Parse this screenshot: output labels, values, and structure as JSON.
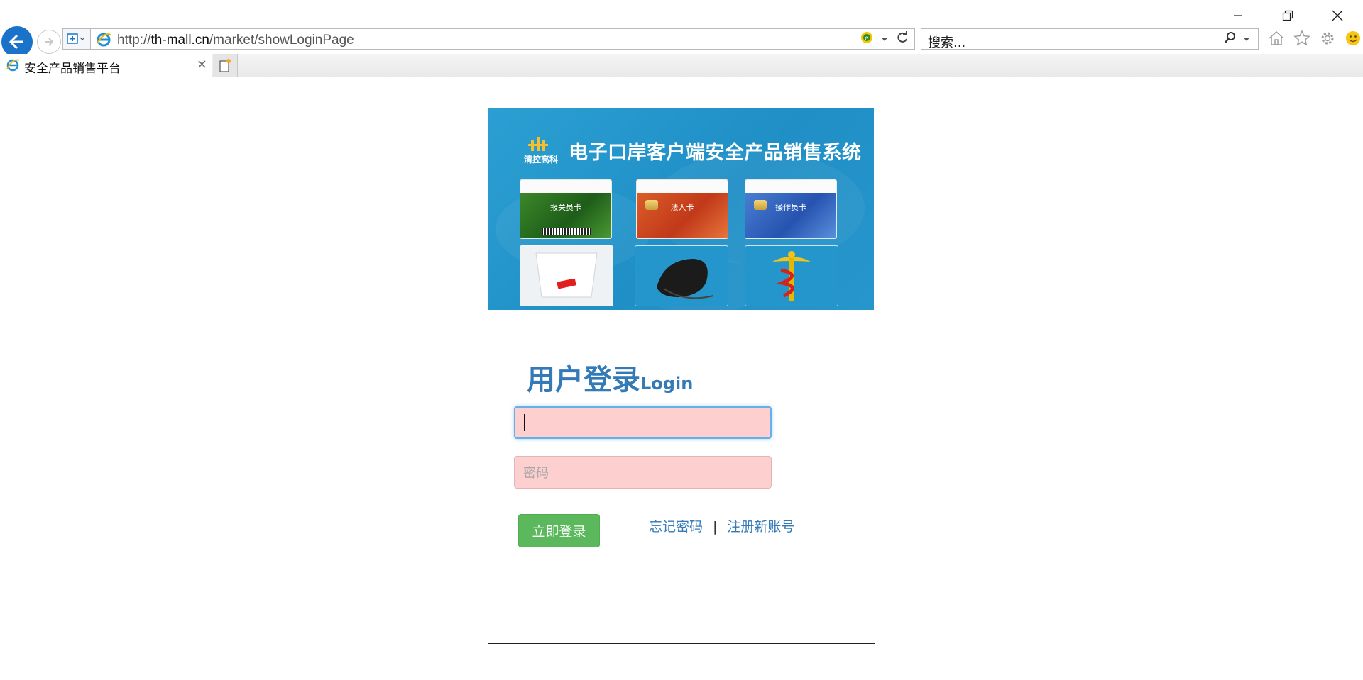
{
  "browser": {
    "url_prefix": "http://",
    "url_domain": "th-mall.cn",
    "url_path": "/market/showLoginPage",
    "search_placeholder": "搜索...",
    "tab_title": "安全产品销售平台",
    "window_controls": [
      "minimize-icon",
      "restore-icon",
      "close-icon"
    ],
    "tool_icons": [
      "home-icon",
      "favorites-star-icon",
      "settings-gear-icon",
      "smiley-feedback-icon"
    ]
  },
  "banner": {
    "logo_text": "清控高科",
    "system_title": "电子口岸客户端安全产品销售系统",
    "cards": [
      {
        "label": "报关员卡",
        "color": "#2f7a2c"
      },
      {
        "label": "法人卡",
        "color": "#d7542a"
      },
      {
        "label": "操作员卡",
        "color": "#3566c0"
      }
    ],
    "devices": [
      "usb-key-box-image",
      "card-reader-image",
      "caduceus-emblem-image"
    ]
  },
  "login": {
    "title": "用户登录",
    "title_en": "Login",
    "username_value": "",
    "password_placeholder": "密码",
    "submit_label": "立即登录",
    "forgot_label": "忘记密码",
    "separator": "|",
    "register_label": "注册新账号"
  },
  "colors": {
    "banner_blue": "#2196cc",
    "title_blue": "#337ab7",
    "input_bg": "#fdcfcf",
    "button_green": "#5cb85c"
  }
}
